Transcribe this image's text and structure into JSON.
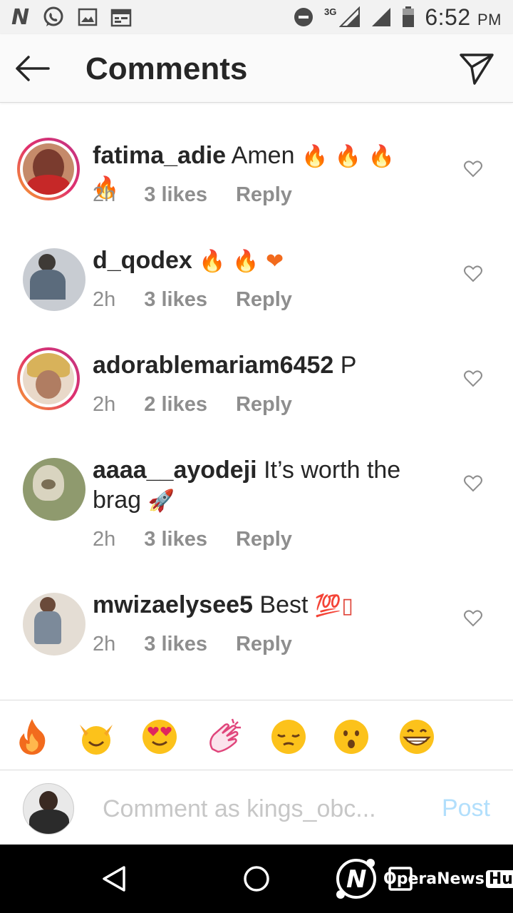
{
  "status_bar": {
    "time": "6:52",
    "ampm": "PM",
    "network": "3G",
    "notification_icons": [
      "n-app-icon",
      "whatsapp-icon",
      "image-icon",
      "calendar-icon"
    ]
  },
  "app_bar": {
    "title": "Comments"
  },
  "comments": [
    {
      "username": "fatima_adie",
      "text": "Amen",
      "emoji": "🔥 🔥 🔥 🔥",
      "time": "2h",
      "likes": "3 likes",
      "reply": "Reply",
      "story_ring": true,
      "avatar_color": "#7a3b2e"
    },
    {
      "username": "d_qodex",
      "text": "",
      "emoji": "🔥 🔥 ❤",
      "time": "2h",
      "likes": "3 likes",
      "reply": "Reply",
      "story_ring": false,
      "avatar_color": "#5b6b7c"
    },
    {
      "username": "adorablemariam6452",
      "text": "P",
      "emoji": "",
      "time": "2h",
      "likes": "2 likes",
      "reply": "Reply",
      "story_ring": true,
      "avatar_color": "#d8b25a"
    },
    {
      "username": "aaaa__ayodeji",
      "text": "It’s worth the brag",
      "emoji": "🚀",
      "time": "2h",
      "likes": "3 likes",
      "reply": "Reply",
      "story_ring": false,
      "avatar_color": "#8f9a6e"
    },
    {
      "username": "mwizaelysee5",
      "text": "Best",
      "emoji": "💯▯",
      "time": "2h",
      "likes": "3 likes",
      "reply": "Reply",
      "story_ring": false,
      "avatar_color": "#b48a6a"
    }
  ],
  "emoji_bar": [
    "🔥",
    "🙌",
    "😍",
    "👏",
    "😔",
    "😮",
    "😁"
  ],
  "comment_input": {
    "placeholder": "Comment as kings_obc...",
    "post_label": "Post"
  },
  "watermark": {
    "brand": "OperaNews",
    "hub": "Hub"
  },
  "colors": {
    "fire": "#f26b1d",
    "heart_pink": "#e0457b",
    "post_disabled": "#b2dffc",
    "meta_gray": "#8e8e8e"
  }
}
